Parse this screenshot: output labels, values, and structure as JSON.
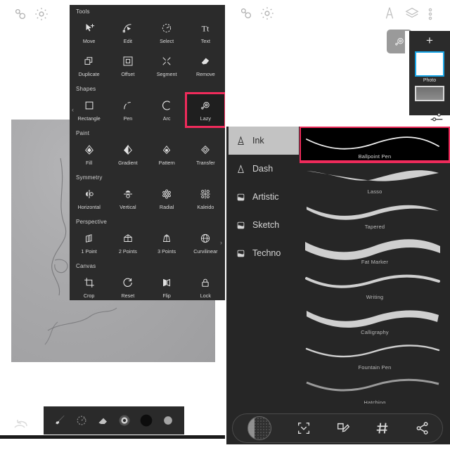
{
  "app": {
    "left_header_icons": [
      "lazy-mouse-icon",
      "gear-icon"
    ],
    "right_header_icons": [
      "brush-icon",
      "layers-icon",
      "overflow-menu-icon"
    ]
  },
  "tools_panel": {
    "title": "Tools",
    "prev_label": "‹",
    "next_label": "›",
    "sections": [
      {
        "name": "Tools",
        "items": [
          {
            "label": "Move",
            "icon": "move-icon",
            "selected": false
          },
          {
            "label": "Edit",
            "icon": "edit-node-icon",
            "selected": false
          },
          {
            "label": "Select",
            "icon": "select-icon",
            "selected": false
          },
          {
            "label": "Text",
            "icon": "text-icon",
            "selected": false
          },
          {
            "label": "Duplicate",
            "icon": "duplicate-icon",
            "selected": false
          },
          {
            "label": "Offset",
            "icon": "offset-icon",
            "selected": false
          },
          {
            "label": "Segment",
            "icon": "segment-icon",
            "selected": false
          },
          {
            "label": "Remove",
            "icon": "remove-icon",
            "selected": false
          }
        ]
      },
      {
        "name": "Shapes",
        "items": [
          {
            "label": "Rectangle",
            "icon": "rectangle-icon",
            "selected": false
          },
          {
            "label": "Pen",
            "icon": "pen-icon",
            "selected": false
          },
          {
            "label": "Arc",
            "icon": "arc-icon",
            "selected": false
          },
          {
            "label": "Lazy",
            "icon": "lazy-icon",
            "selected": true
          }
        ]
      },
      {
        "name": "Paint",
        "items": [
          {
            "label": "Fill",
            "icon": "fill-icon",
            "selected": false
          },
          {
            "label": "Gradient",
            "icon": "gradient-icon",
            "selected": false
          },
          {
            "label": "Pattern",
            "icon": "pattern-icon",
            "selected": false
          },
          {
            "label": "Transfer",
            "icon": "transfer-icon",
            "selected": false
          }
        ]
      },
      {
        "name": "Symmetry",
        "items": [
          {
            "label": "Horizontal",
            "icon": "symmetry-horizontal-icon",
            "selected": false
          },
          {
            "label": "Vertical",
            "icon": "symmetry-vertical-icon",
            "selected": false
          },
          {
            "label": "Radial",
            "icon": "symmetry-radial-icon",
            "selected": false
          },
          {
            "label": "Kaleido",
            "icon": "symmetry-kaleido-icon",
            "selected": false
          }
        ]
      },
      {
        "name": "Perspective",
        "items": [
          {
            "label": "1 Point",
            "icon": "perspective-1-point-icon",
            "selected": false
          },
          {
            "label": "2 Points",
            "icon": "perspective-2-points-icon",
            "selected": false
          },
          {
            "label": "3 Points",
            "icon": "perspective-3-points-icon",
            "selected": false
          },
          {
            "label": "Curvilinear",
            "icon": "perspective-curvilinear-icon",
            "selected": false
          }
        ]
      },
      {
        "name": "Canvas",
        "items": [
          {
            "label": "Crop",
            "icon": "crop-icon",
            "selected": false
          },
          {
            "label": "Reset",
            "icon": "reset-icon",
            "selected": false
          },
          {
            "label": "Flip",
            "icon": "flip-icon",
            "selected": false
          },
          {
            "label": "Lock",
            "icon": "lock-icon",
            "selected": false
          }
        ]
      }
    ]
  },
  "left_dock": {
    "undo_icon": "undo-icon",
    "items": [
      {
        "name": "brush-tool",
        "icon": "brush-icon"
      },
      {
        "name": "smudge-tool",
        "icon": "smudge-icon"
      },
      {
        "name": "eraser-tool",
        "icon": "eraser-icon"
      },
      {
        "name": "color-wheel",
        "icon": "color-wheel-icon"
      },
      {
        "name": "color-swatch-black",
        "icon": "circle-icon",
        "color": "#0b0b0b"
      },
      {
        "name": "color-swatch-gray",
        "icon": "circle-icon",
        "color": "#b0b0b0"
      }
    ]
  },
  "lazy_button": {
    "label": "Lazy",
    "icon": "lazy-icon",
    "active": true
  },
  "layers_panel": {
    "add_label": "+",
    "settings_icon": "sliders-icon",
    "layers": [
      {
        "name": "Photo",
        "selected": true,
        "selection_color": "#18a5e6"
      },
      {
        "name": "",
        "selected": false
      }
    ]
  },
  "brush_panel": {
    "categories": [
      {
        "label": "Ink",
        "icon": "ink-icon",
        "selected": true
      },
      {
        "label": "Dash",
        "icon": "dash-icon",
        "selected": false
      },
      {
        "label": "Artistic",
        "icon": "artistic-icon",
        "selected": false
      },
      {
        "label": "Sketch",
        "icon": "sketch-icon",
        "selected": false
      },
      {
        "label": "Techno",
        "icon": "techno-icon",
        "selected": false
      }
    ],
    "brushes": [
      {
        "label": "Ballpoint Pen",
        "selected": true,
        "stroke": "thin"
      },
      {
        "label": "Lasso",
        "selected": false,
        "stroke": "lasso"
      },
      {
        "label": "Tapered",
        "selected": false,
        "stroke": "tapered"
      },
      {
        "label": "Fat Marker",
        "selected": false,
        "stroke": "fat"
      },
      {
        "label": "Writing",
        "selected": false,
        "stroke": "writing"
      },
      {
        "label": "Calligraphy",
        "selected": false,
        "stroke": "calligraphy"
      },
      {
        "label": "Fountain Pen",
        "selected": false,
        "stroke": "fountain"
      },
      {
        "label": "Hatching",
        "selected": false,
        "stroke": "thin"
      }
    ],
    "selection_color": "#ef2b5b"
  },
  "right_dock": {
    "items": [
      {
        "name": "pattern-swatch",
        "icon": "dither-swatch-icon"
      },
      {
        "name": "fit-screen-button",
        "icon": "fit-screen-icon"
      },
      {
        "name": "edit-brush-button",
        "icon": "edit-brush-icon"
      },
      {
        "name": "grid-button",
        "icon": "hash-icon"
      },
      {
        "name": "share-button",
        "icon": "share-icon"
      }
    ]
  }
}
